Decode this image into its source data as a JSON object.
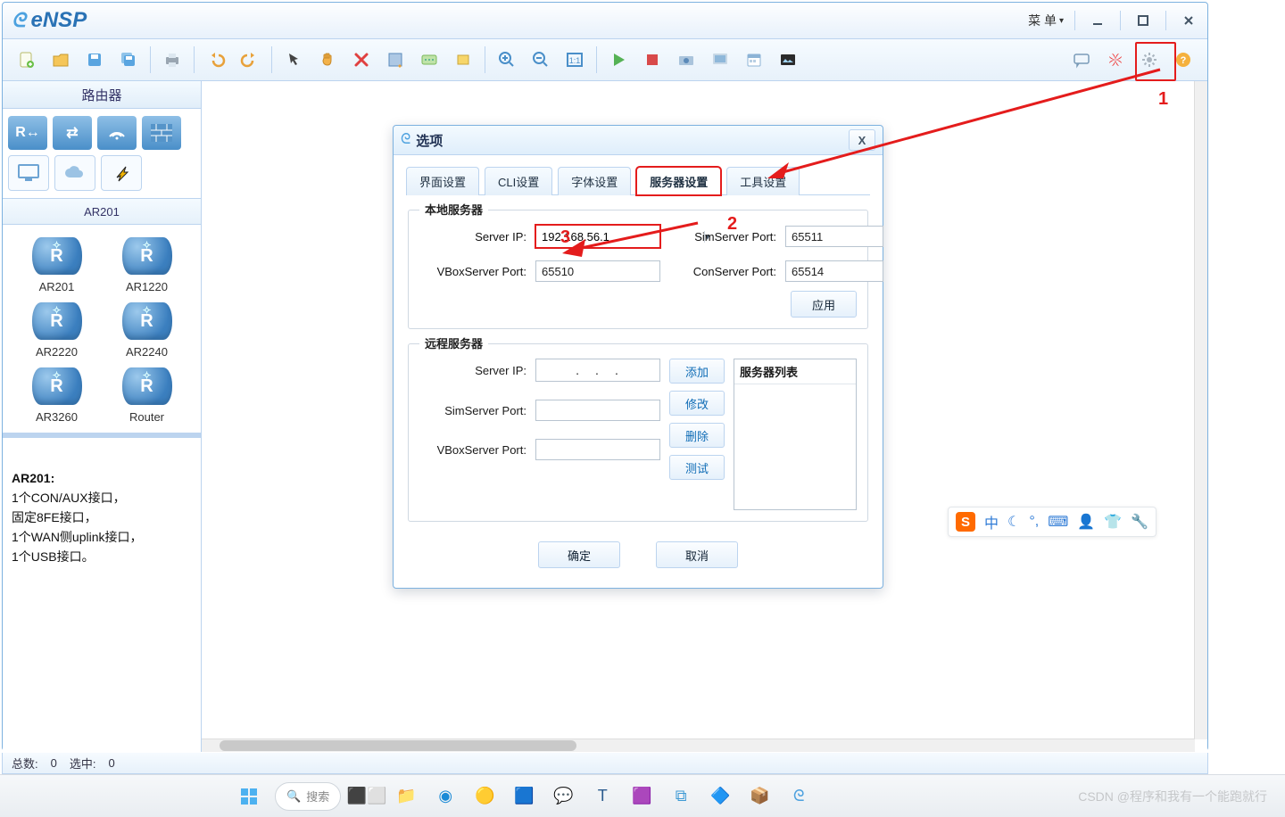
{
  "app": {
    "title": "eNSP",
    "menu_label": "菜 单"
  },
  "left_panel": {
    "section_title": "路由器",
    "subsection_title": "AR201",
    "devices": [
      {
        "name": "AR201"
      },
      {
        "name": "AR1220"
      },
      {
        "name": "AR2220"
      },
      {
        "name": "AR2240"
      },
      {
        "name": "AR3260"
      },
      {
        "name": "Router"
      }
    ],
    "desc_title": "AR201:",
    "desc_body": "1个CON/AUX接口，\n固定8FE接口，\n1个WAN侧uplink接口，\n1个USB接口。"
  },
  "dialog": {
    "title": "选项",
    "close_glyph": "X",
    "tabs": [
      "界面设置",
      "CLI设置",
      "字体设置",
      "服务器设置",
      "工具设置"
    ],
    "active_tab_index": 3,
    "local_group": {
      "legend": "本地服务器",
      "labels": {
        "server_ip": "Server IP:",
        "sim_port": "SimServer Port:",
        "vbox_port": "VBoxServer Port:",
        "con_port": "ConServer Port:"
      },
      "values": {
        "server_ip": "192.168.56.1",
        "sim_port": "65511",
        "vbox_port": "65510",
        "con_port": "65514"
      },
      "apply_btn": "应用"
    },
    "remote_group": {
      "legend": "远程服务器",
      "labels": {
        "server_ip": "Server IP:",
        "sim_port": "SimServer Port:",
        "vbox_port": "VBoxServer Port:"
      },
      "values": {
        "server_ip": "   .   .   .   ",
        "sim_port": "",
        "vbox_port": ""
      },
      "btns": {
        "add": "添加",
        "modify": "修改",
        "delete": "删除",
        "test": "测试"
      },
      "list_header": "服务器列表"
    },
    "footer": {
      "ok": "确定",
      "cancel": "取消"
    }
  },
  "annotations": {
    "n1": "1",
    "n2": "2",
    "n3": "3"
  },
  "status": {
    "total_label": "总数:",
    "total": "0",
    "sel_label": "选中:",
    "sel": "0"
  },
  "taskbar": {
    "search_placeholder": "搜索"
  },
  "watermark": "CSDN @程序和我有一个能跑就行",
  "ime": {
    "s": "S",
    "lang": "中"
  }
}
